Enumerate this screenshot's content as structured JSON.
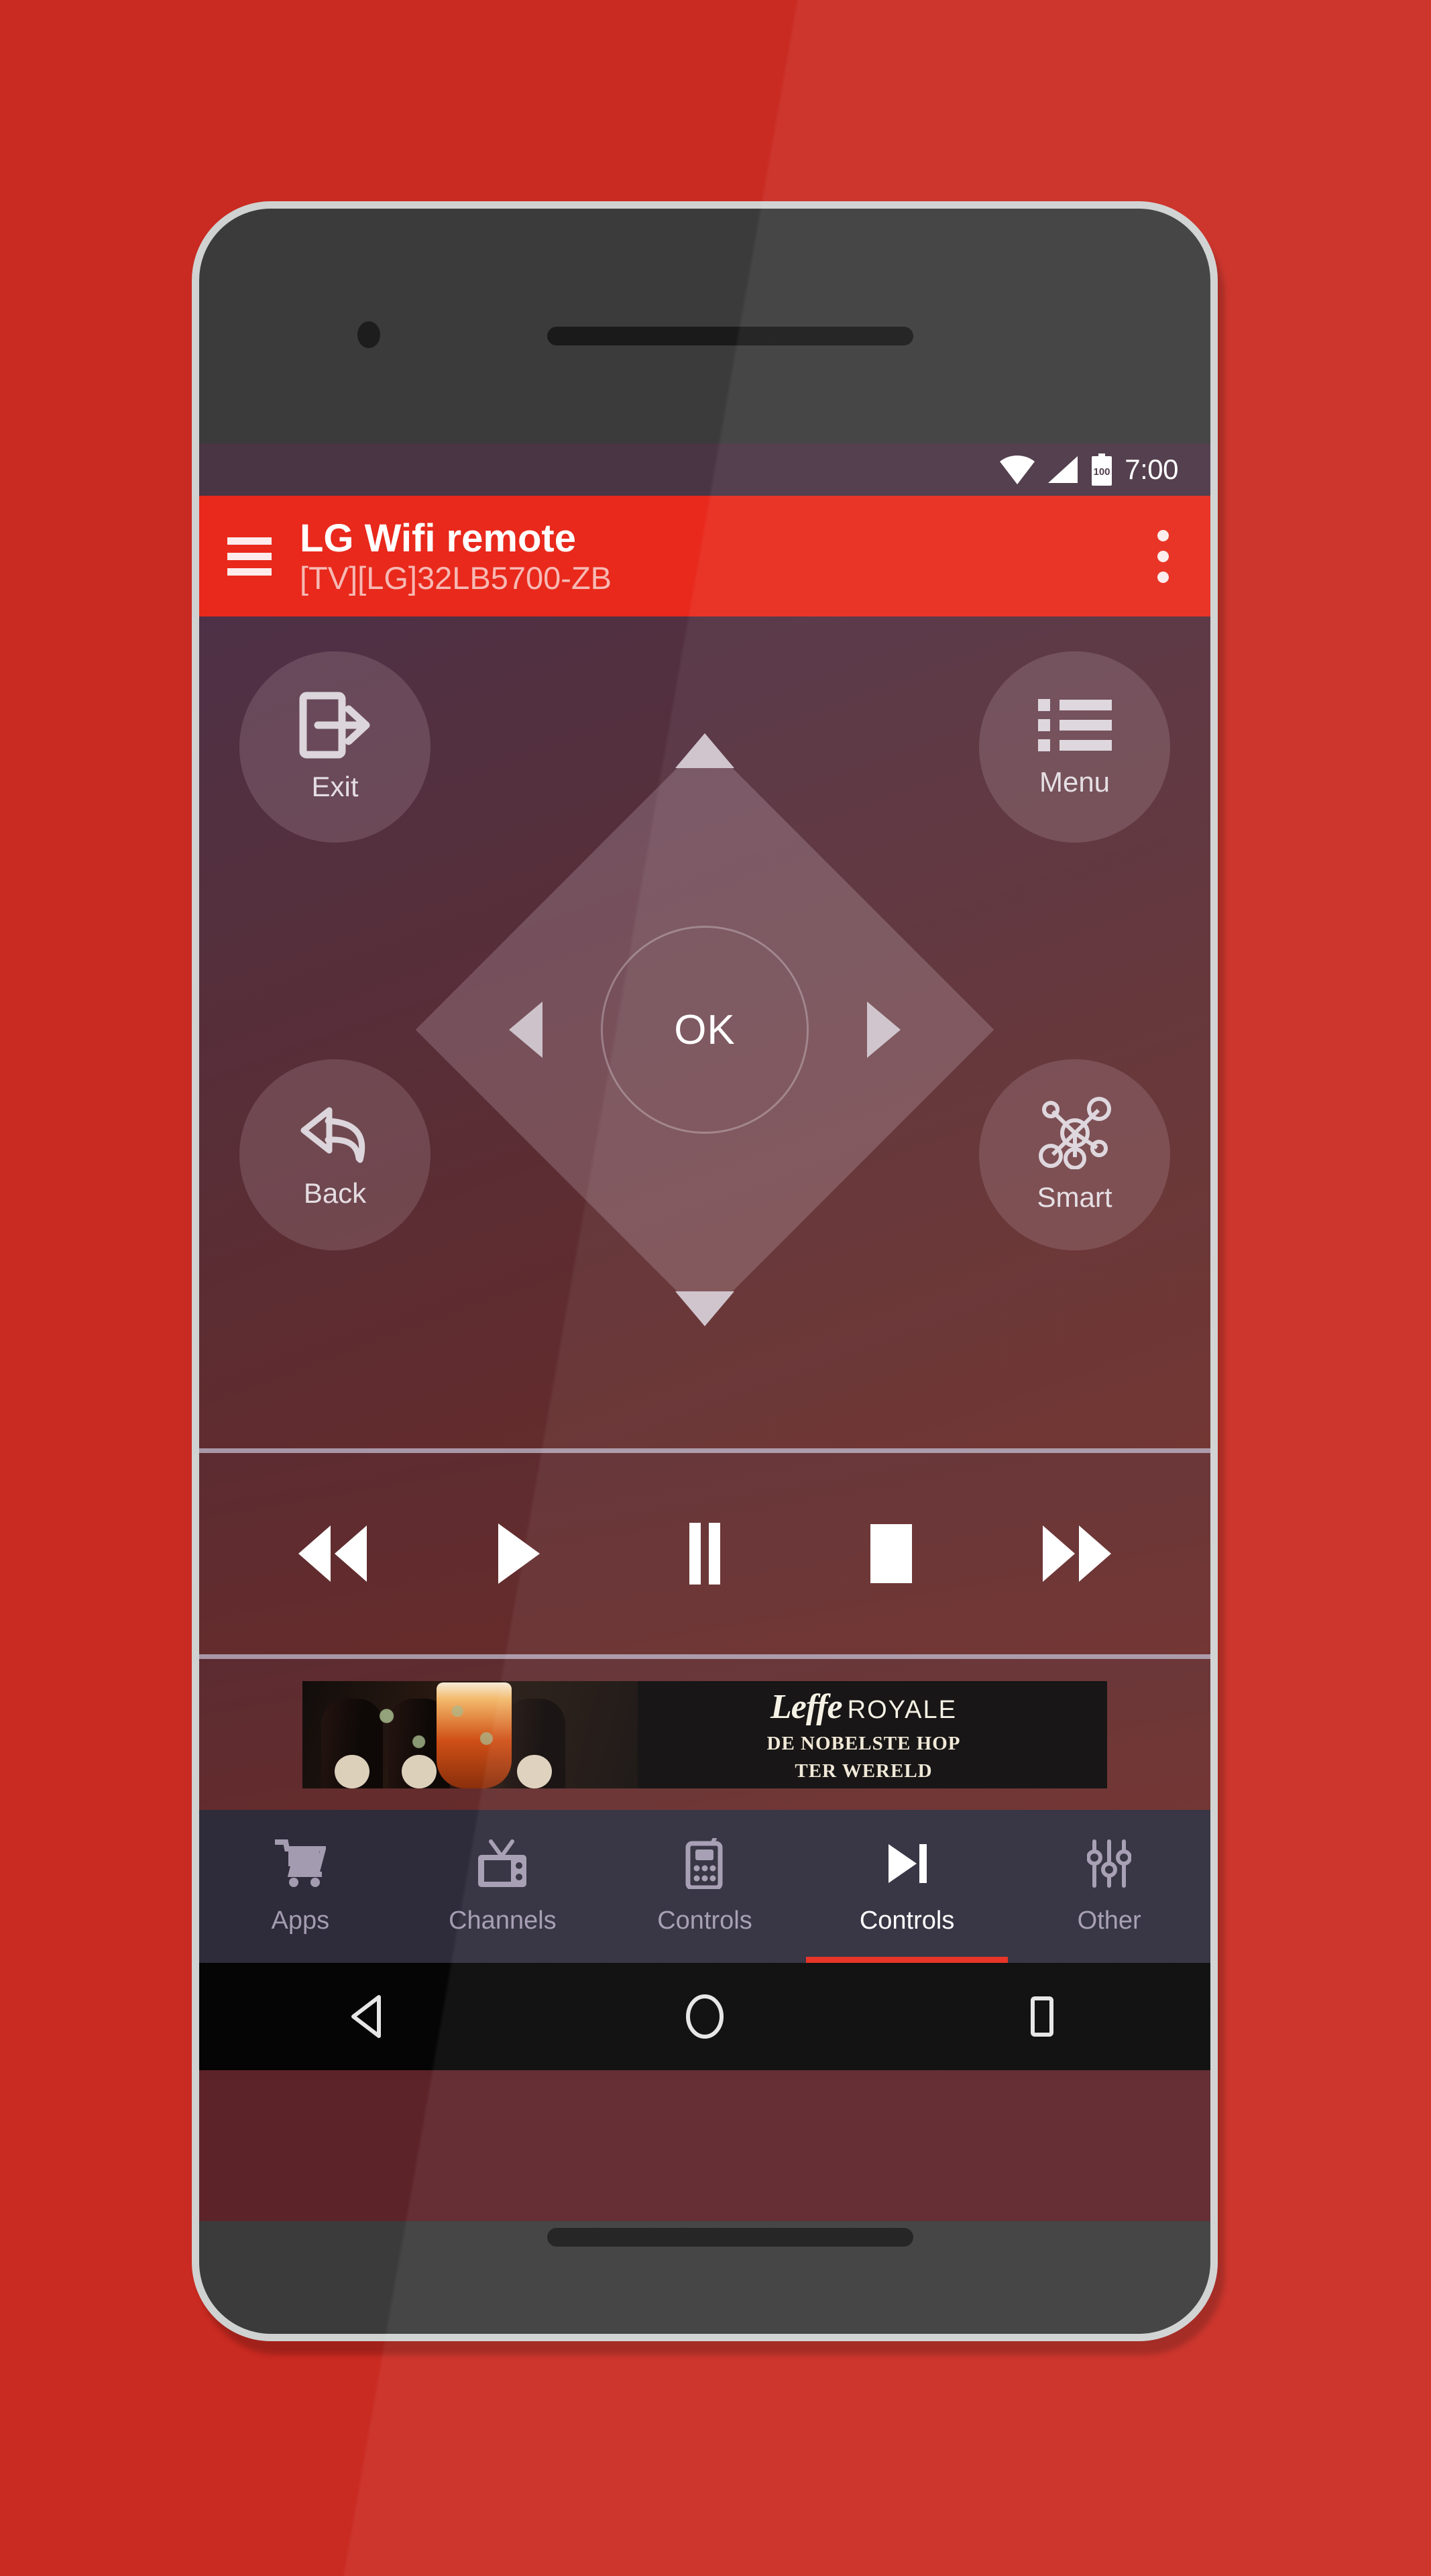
{
  "status_bar": {
    "time": "7:00",
    "battery_level": "100",
    "wifi_icon": "wifi-icon",
    "signal_icon": "cellular-signal-icon",
    "battery_icon": "battery-icon"
  },
  "app_bar": {
    "menu_icon": "hamburger-menu-icon",
    "title": "LG Wifi remote",
    "subtitle": "[TV][LG]32LB5700-ZB",
    "overflow_icon": "overflow-menu-icon",
    "background_color": "#e8291c"
  },
  "remote": {
    "corner_buttons": [
      {
        "id": "exit",
        "label": "Exit",
        "icon": "exit-door-arrow-icon"
      },
      {
        "id": "menu",
        "label": "Menu",
        "icon": "list-menu-icon"
      },
      {
        "id": "back",
        "label": "Back",
        "icon": "back-reply-arrow-icon"
      },
      {
        "id": "smart",
        "label": "Smart",
        "icon": "smart-hub-network-icon"
      }
    ],
    "dpad": {
      "ok_label": "OK",
      "up_icon": "arrow-up-icon",
      "down_icon": "arrow-down-icon",
      "left_icon": "arrow-left-icon",
      "right_icon": "arrow-right-icon"
    }
  },
  "media_controls": [
    {
      "id": "rewind",
      "icon": "rewind-icon"
    },
    {
      "id": "play",
      "icon": "play-icon"
    },
    {
      "id": "pause",
      "icon": "pause-icon"
    },
    {
      "id": "stop",
      "icon": "stop-icon"
    },
    {
      "id": "fast-forward",
      "icon": "fast-forward-icon"
    }
  ],
  "ad_banner": {
    "brand": "Leffe",
    "brand_sub": "ROYALE",
    "tagline_line1": "DE NOBELSTE HOP",
    "tagline_line2": "TER WERELD"
  },
  "bottom_nav": {
    "active_index": 3,
    "accent_color": "#e8291c",
    "items": [
      {
        "label": "Apps",
        "icon": "shopping-cart-icon"
      },
      {
        "label": "Channels",
        "icon": "television-icon"
      },
      {
        "label": "Controls",
        "icon": "remote-control-icon"
      },
      {
        "label": "Controls",
        "icon": "skip-next-icon"
      },
      {
        "label": "Other",
        "icon": "sliders-icon"
      }
    ]
  },
  "android_nav": {
    "back_icon": "android-back-icon",
    "home_icon": "android-home-icon",
    "recents_icon": "android-recents-icon"
  }
}
